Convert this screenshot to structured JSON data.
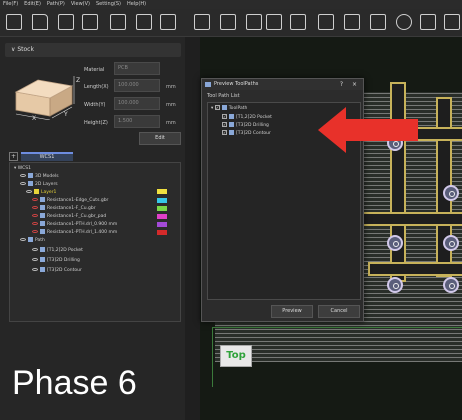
{
  "menu": [
    "File(F)",
    "Edit(E)",
    "Path(P)",
    "View(V)",
    "Setting(S)",
    "Help(H)"
  ],
  "stock": {
    "header": "Stock",
    "material_label": "Material",
    "material_value": "PCB",
    "length_label": "Length(X)",
    "length_value": "100.000",
    "width_label": "Width(Y)",
    "width_value": "100.000",
    "height_label": "Height(Z)",
    "height_value": "1.500",
    "unit": "mm",
    "edit_label": "Edit",
    "axis_x": "X",
    "axis_y": "Y",
    "axis_z": "Z"
  },
  "tree": {
    "tab_plus": "+",
    "tab_label": "WCS1",
    "root": "WCS1",
    "models": "3D Models",
    "layers": "2D Layers",
    "layer1": "Layer1",
    "layer_items": [
      {
        "label": "Resistance1-Edge_Cuts.gbr",
        "color": "#f0e040"
      },
      {
        "label": "Resistance1-F_Cu.gbr",
        "color": "#36c8e8"
      },
      {
        "label": "Resistance1-F_Cu.gbr_pad",
        "color": "#7ad848"
      },
      {
        "label": "Resistance1-PTH.drl_0.900 mm",
        "color": "#e040c8"
      },
      {
        "label": "Resistance1-PTH.drl_1.400 mm",
        "color": "#d42a2a"
      }
    ],
    "path": "Path",
    "paths": [
      "[T1,2]2D Pocket",
      "[T3]2D Drilling",
      "[T3]2D Contour"
    ]
  },
  "dialog": {
    "title": "Preview ToolPaths",
    "help": "?",
    "close": "×",
    "group": "Tool Path List",
    "root": "ToolPath",
    "items": [
      "[T1,2]2D Pocket",
      "[T3]2D Drilling",
      "[T3]2D Contour"
    ],
    "preview": "Preview",
    "cancel": "Cancel"
  },
  "canvas": {
    "top_label": "Top",
    "phase_label": "Phase 6"
  },
  "colors": {
    "arrow": "#e8312a",
    "trace_outline": "#c7b25a",
    "top_text": "#2fa23a"
  }
}
